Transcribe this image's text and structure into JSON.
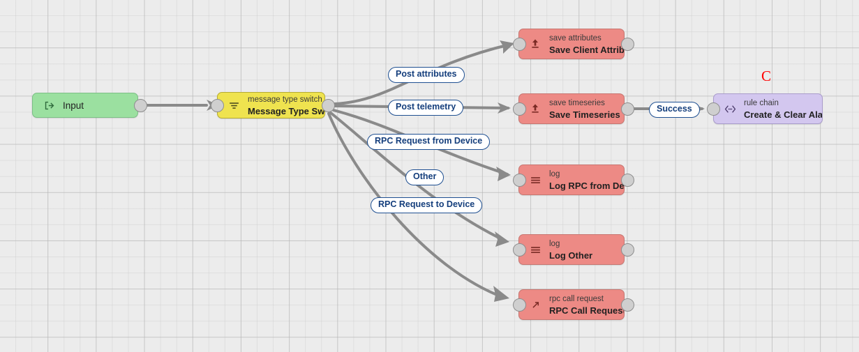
{
  "canvas": {
    "background_color": "#ececec",
    "grid_color": "#cdcdcd"
  },
  "nodes": [
    {
      "id": "input",
      "icon": "input-arrow-icon",
      "type_label": "",
      "title": "Input",
      "color": "#9be0a0",
      "kind": "green"
    },
    {
      "id": "message-type-switch",
      "icon": "filter-icon",
      "type_label": "message type switch",
      "title": "Message Type Switch",
      "color": "#efe34f",
      "kind": "yellow"
    },
    {
      "id": "save-client-attributes",
      "icon": "upload-icon",
      "type_label": "save attributes",
      "title": "Save Client Attributes",
      "color": "#ed8a85",
      "kind": "red"
    },
    {
      "id": "save-timeseries",
      "icon": "upload-icon",
      "type_label": "save timeseries",
      "title": "Save Timeseries",
      "color": "#ed8a85",
      "kind": "red"
    },
    {
      "id": "log-rpc-from-device",
      "icon": "log-lines-icon",
      "type_label": "log",
      "title": "Log RPC from Device",
      "color": "#ed8a85",
      "kind": "red"
    },
    {
      "id": "log-other",
      "icon": "log-lines-icon",
      "type_label": "log",
      "title": "Log Other",
      "color": "#ed8a85",
      "kind": "red"
    },
    {
      "id": "rpc-call-request",
      "icon": "diagonal-arrow-icon",
      "type_label": "rpc call request",
      "title": "RPC Call Request",
      "color": "#ed8a85",
      "kind": "red"
    },
    {
      "id": "create-clear-alarm",
      "icon": "rule-chain-icon",
      "type_label": "rule chain",
      "title": "Create & Clear Alarm...",
      "color": "#d3c7ef",
      "kind": "purple"
    }
  ],
  "link_labels": [
    {
      "id": "post-attributes",
      "text": "Post attributes"
    },
    {
      "id": "post-telemetry",
      "text": "Post telemetry"
    },
    {
      "id": "rpc-request-from-device",
      "text": "RPC Request from Device"
    },
    {
      "id": "other",
      "text": "Other"
    },
    {
      "id": "rpc-request-to-device",
      "text": "RPC Request to Device"
    },
    {
      "id": "success",
      "text": "Success"
    }
  ],
  "annotations": {
    "cursor_marker": "C",
    "cursor_marker_color": "#ff0000"
  }
}
